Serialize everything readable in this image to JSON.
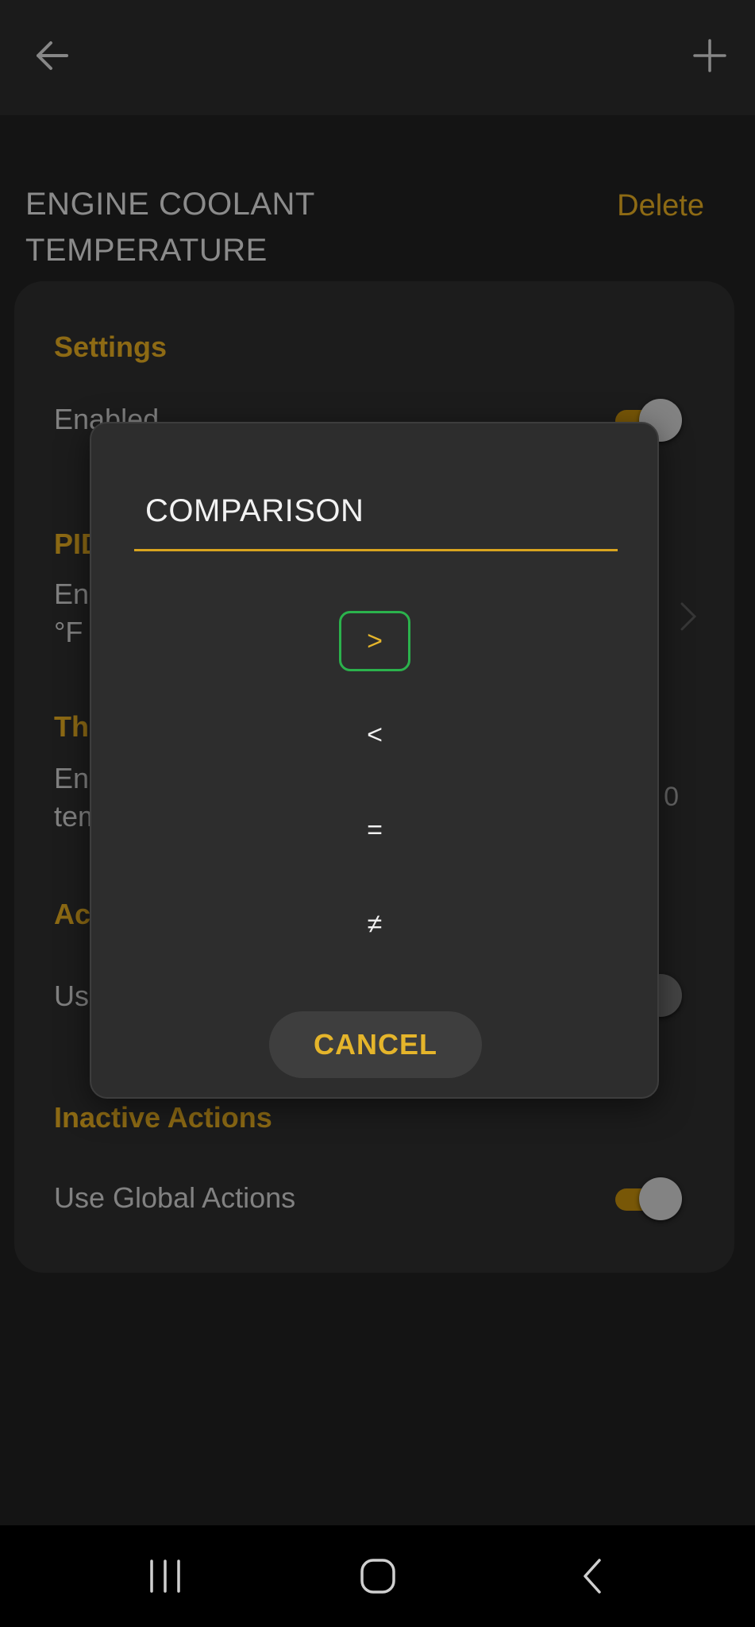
{
  "header": {
    "back_icon": "arrow-left-icon",
    "add_icon": "plus-icon"
  },
  "page": {
    "title_line1": "ENGINE COOLANT",
    "title_line2": "TEMPERATURE",
    "delete_label": "Delete"
  },
  "card": {
    "settings_heading": "Settings",
    "enabled_label": "Enabled",
    "enabled_on": true,
    "pid_heading": "PID",
    "pid_label_line1": "Eng",
    "pid_label_line2": "°F",
    "threshold_heading": "Thr",
    "threshold_label_line1": "Eng",
    "threshold_label_line2": "tem",
    "threshold_value": "0",
    "actions_heading": "Act",
    "actions_use_label": "Use",
    "actions_use_on": false,
    "inactive_heading": "Inactive Actions",
    "inactive_use_label": "Use Global Actions",
    "inactive_use_on": true
  },
  "dialog": {
    "title": "COMPARISON",
    "options": [
      ">",
      "<",
      "=",
      "≠"
    ],
    "selected_index": 0,
    "cancel_label": "CANCEL"
  },
  "colors": {
    "accent": "#d9a41f",
    "selected_border": "#2bb24c",
    "background": "#1f1f1f",
    "card": "#2b2b2b"
  },
  "navbar": {
    "recents_icon": "recents-icon",
    "home_icon": "home-icon",
    "back_icon": "nav-back-icon"
  }
}
